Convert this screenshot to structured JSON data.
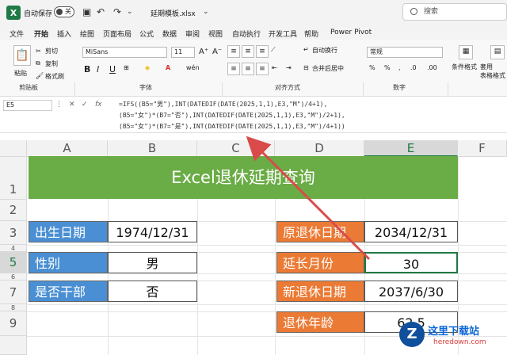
{
  "titlebar": {
    "autosave_label": "自动保存",
    "toggle_state": "关",
    "filename": "延期模板.xlsx",
    "dropdown_glyph": "⌄",
    "search_placeholder": "搜索"
  },
  "menu": [
    "文件",
    "开始",
    "插入",
    "绘图",
    "页面布局",
    "公式",
    "数据",
    "审阅",
    "视图",
    "自动执行",
    "开发工具",
    "帮助",
    "Power Pivot"
  ],
  "ribbon": {
    "paste": "粘贴",
    "cut": "剪切",
    "copy": "复制",
    "format_painter": "格式刷",
    "clipboard_group": "剪贴板",
    "font_name": "MiSans",
    "font_size": "11",
    "font_group": "字体",
    "wrap_text": "自动换行",
    "merge_center": "合并后居中",
    "alignment_group": "对齐方式",
    "number_format": "常规",
    "number_group": "数字",
    "conditional_format": "条件格式",
    "table_format": "套用\n表格格式"
  },
  "formula_bar": {
    "name_box": "E5",
    "fx": "fx",
    "lines": [
      "=IFS((B5=\"男\"),INT(DATEDIF(DATE(2025,1,1),E3,\"M\")/4+1),",
      "(B5=\"女\")*(B7=\"否\"),INT(DATEDIF(DATE(2025,1,1),E3,\"M\")/2+1),",
      "(B5=\"女\")*(B7=\"是\"),INT(DATEDIF(DATE(2025,1,1),E3,\"M\")/4+1))"
    ]
  },
  "sheet": {
    "columns": [
      "A",
      "B",
      "C",
      "D",
      "E",
      "F"
    ],
    "rows": [
      "1",
      "2",
      "3",
      "4",
      "5",
      "6",
      "7",
      "8",
      "9"
    ],
    "title": "Excel退休延期查询",
    "left_labels": [
      "出生日期",
      "性别",
      "是否干部"
    ],
    "left_values": [
      "1974/12/31",
      "男",
      "否"
    ],
    "right_labels": [
      "原退休日期",
      "延长月份",
      "新退休日期",
      "退休年龄"
    ],
    "right_values": [
      "2034/12/31",
      "30",
      "2037/6/30",
      "62.5"
    ]
  },
  "watermark": {
    "logo": "Z",
    "name": "这里下载站",
    "url": "heredown.com"
  },
  "colors": {
    "title_band": "#6aac45",
    "left_label": "#4a8fd3",
    "right_label": "#eb7a34",
    "excel_green": "#1f7a45",
    "arrow": "#d94b4b"
  }
}
